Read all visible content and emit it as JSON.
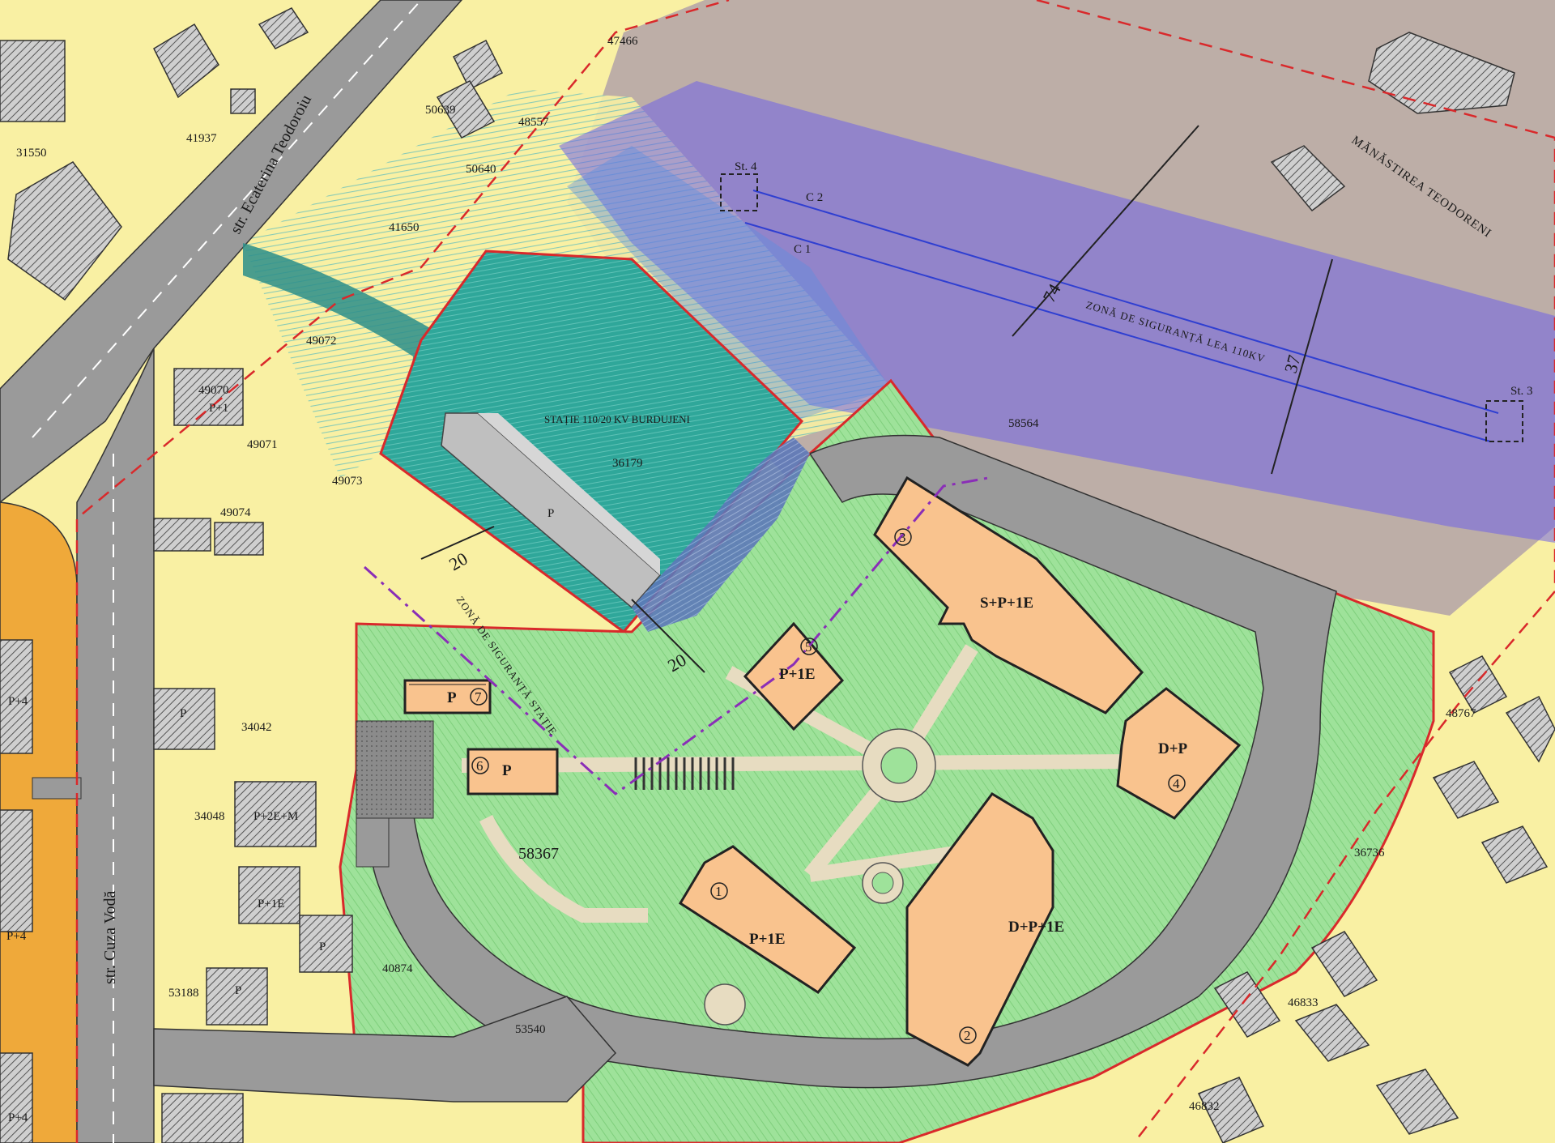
{
  "colors": {
    "background": "#f9f0a3",
    "monastery_area": "#bdaea7",
    "safety_zone_line": "#6f62e8",
    "station_fill": "#2fa79a",
    "green_area": "#9ee29a",
    "building_fill": "#f9c38e",
    "road": "#9a9a9a",
    "main_street_edge": "#efa93a",
    "boundary_red": "#d9292b",
    "boundary_purple": "#8a2eb7"
  },
  "streets": {
    "teodoroiu": "str. Ecaterina Teodoroiu",
    "cuza": "str. Cuza Vodă"
  },
  "parcels": {
    "p31550": "31550",
    "p41937": "41937",
    "p47466": "47466",
    "p50639": "50639",
    "p48557": "48557",
    "p50640": "50640",
    "p41650": "41650",
    "p49072": "49072",
    "p49070": "49070",
    "p49071": "49071",
    "p49073": "49073",
    "p49074": "49074",
    "p36179": "36179",
    "p58564": "58564",
    "p34042": "34042",
    "p34048": "34048",
    "p58367": "58367",
    "p40874": "40874",
    "p53188": "53188",
    "p53540": "53540",
    "p48767": "48767",
    "p36736": "36736",
    "p46833": "46833",
    "p46832": "46832"
  },
  "heights": {
    "p1": "P+1",
    "p": "P",
    "p4": "P+4",
    "p2em": "P+2E+M",
    "p1e": "P+1E"
  },
  "station": {
    "title": "STAȚIE 110/20 KV BURDUJENI"
  },
  "zones": {
    "lea": "ZONĂ DE SIGURANȚĂ LEA 110KV",
    "statie": "ZONĂ DE SIGURANȚĂ STAȚIE"
  },
  "monastery": "MĂNĂSTIREA TEODORENI",
  "stations": {
    "st4": "St. 4",
    "st3": "St. 3",
    "c1": "C 1",
    "c2": "C 2"
  },
  "dimensions": {
    "d74": "74",
    "d37": "37",
    "d20a": "20",
    "d20b": "20"
  },
  "buildings": [
    {
      "num": "1",
      "label": "P+1E"
    },
    {
      "num": "2",
      "label": "D+P+1E"
    },
    {
      "num": "3",
      "label": "S+P+1E"
    },
    {
      "num": "4",
      "label": "D+P"
    },
    {
      "num": "5",
      "label": "P+1E"
    },
    {
      "num": "6",
      "label": "P"
    },
    {
      "num": "7",
      "label": "P"
    }
  ]
}
